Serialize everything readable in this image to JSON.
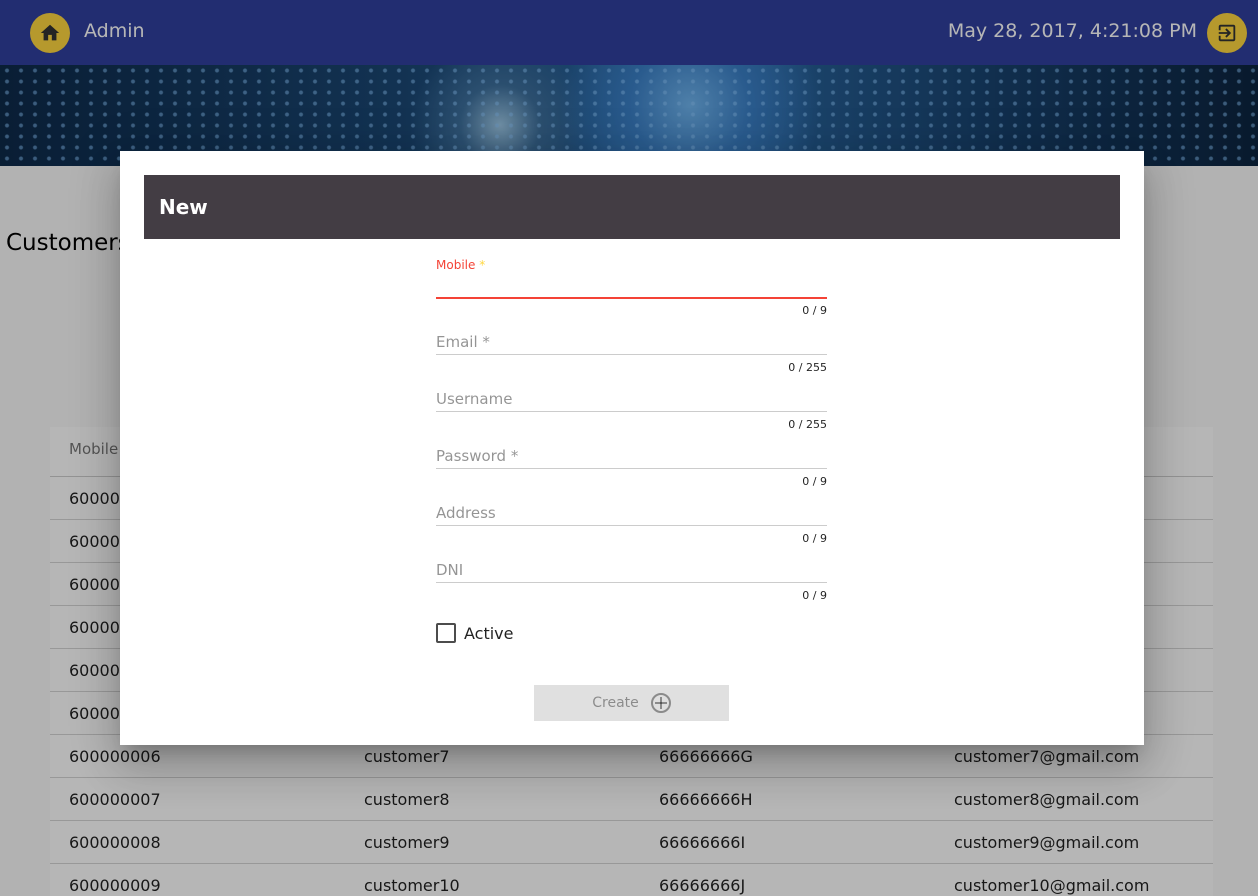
{
  "header": {
    "app_title": "Admin",
    "datetime": "May 28, 2017, 4:21:08 PM",
    "home_icon": "home-icon",
    "logout_icon": "exit-to-app-icon"
  },
  "page": {
    "title": "Customers"
  },
  "table": {
    "columns": [
      "Mobile"
    ],
    "rows": [
      [
        "600000",
        "",
        "",
        ""
      ],
      [
        "600000",
        "",
        "",
        ""
      ],
      [
        "600000",
        "",
        "",
        ""
      ],
      [
        "600000",
        "",
        "",
        ""
      ],
      [
        "600000",
        "",
        "",
        ""
      ],
      [
        "600000",
        "",
        "",
        ""
      ],
      [
        "600000006",
        "customer7",
        "66666666G",
        "customer7@gmail.com"
      ],
      [
        "600000007",
        "customer8",
        "66666666H",
        "customer8@gmail.com"
      ],
      [
        "600000008",
        "customer9",
        "66666666I",
        "customer9@gmail.com"
      ],
      [
        "600000009",
        "customer10",
        "66666666J",
        "customer10@gmail.com"
      ]
    ]
  },
  "dialog": {
    "title": "New",
    "fields": [
      {
        "label": "Mobile",
        "required": "*",
        "counter": "0 / 9",
        "focused": true
      },
      {
        "label": "Email *",
        "counter": "0 / 255"
      },
      {
        "label": "Username",
        "counter": "0 / 255"
      },
      {
        "label": "Password *",
        "counter": "0 / 9"
      },
      {
        "label": "Address",
        "counter": "0 / 9"
      },
      {
        "label": "DNI",
        "counter": "0 / 9"
      }
    ],
    "active_label": "Active",
    "active_checked": false,
    "create_label": "Create",
    "create_icon": "add-circle-outline-icon"
  },
  "colors": {
    "toolbar": "#303f9f",
    "accent": "#ffd740",
    "warn": "#f44336",
    "dialog_header": "#433d44"
  }
}
